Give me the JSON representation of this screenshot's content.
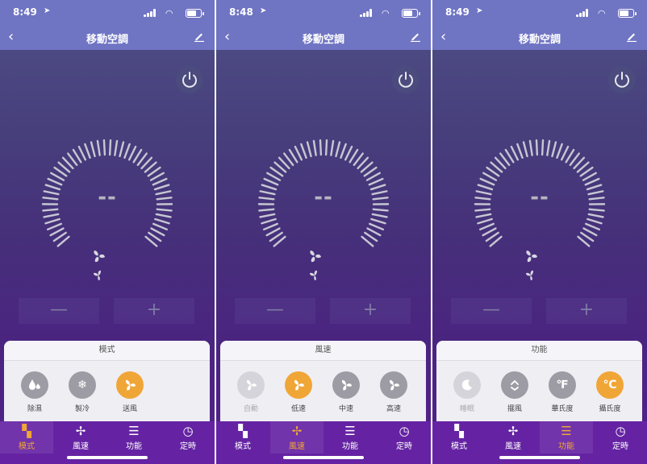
{
  "common": {
    "title": "移動空調",
    "temperature": "--",
    "minus_label": "—",
    "plus_label": "+"
  },
  "tabs": [
    "模式",
    "風速",
    "功能",
    "定時"
  ],
  "colors": {
    "accent": "#f0a637",
    "header": "#6f74c3",
    "tabbar": "#6523a3"
  },
  "screens": [
    {
      "time": "8:49",
      "panel_title": "模式",
      "active_tab": 0,
      "options": [
        {
          "label": "除濕",
          "icon": "droplets-icon",
          "state": "normal"
        },
        {
          "label": "製冷",
          "icon": "snowflake-icon",
          "state": "normal"
        },
        {
          "label": "送風",
          "icon": "fan-icon",
          "state": "selected"
        }
      ]
    },
    {
      "time": "8:48",
      "panel_title": "風速",
      "active_tab": 1,
      "options": [
        {
          "label": "自動",
          "icon": "fan-auto-icon",
          "state": "disabled"
        },
        {
          "label": "低速",
          "icon": "fan-icon",
          "state": "selected"
        },
        {
          "label": "中速",
          "icon": "fan-icon",
          "state": "normal"
        },
        {
          "label": "高速",
          "icon": "fan-icon",
          "state": "normal"
        }
      ]
    },
    {
      "time": "8:49",
      "panel_title": "功能",
      "active_tab": 2,
      "options": [
        {
          "label": "睡眠",
          "icon": "moon-icon",
          "state": "disabled"
        },
        {
          "label": "擺風",
          "icon": "swing-icon",
          "state": "normal"
        },
        {
          "label": "華氏度",
          "icon": "fahrenheit-icon",
          "state": "normal",
          "glyph": "℉"
        },
        {
          "label": "攝氏度",
          "icon": "celsius-icon",
          "state": "selected",
          "glyph": "℃"
        }
      ]
    }
  ]
}
